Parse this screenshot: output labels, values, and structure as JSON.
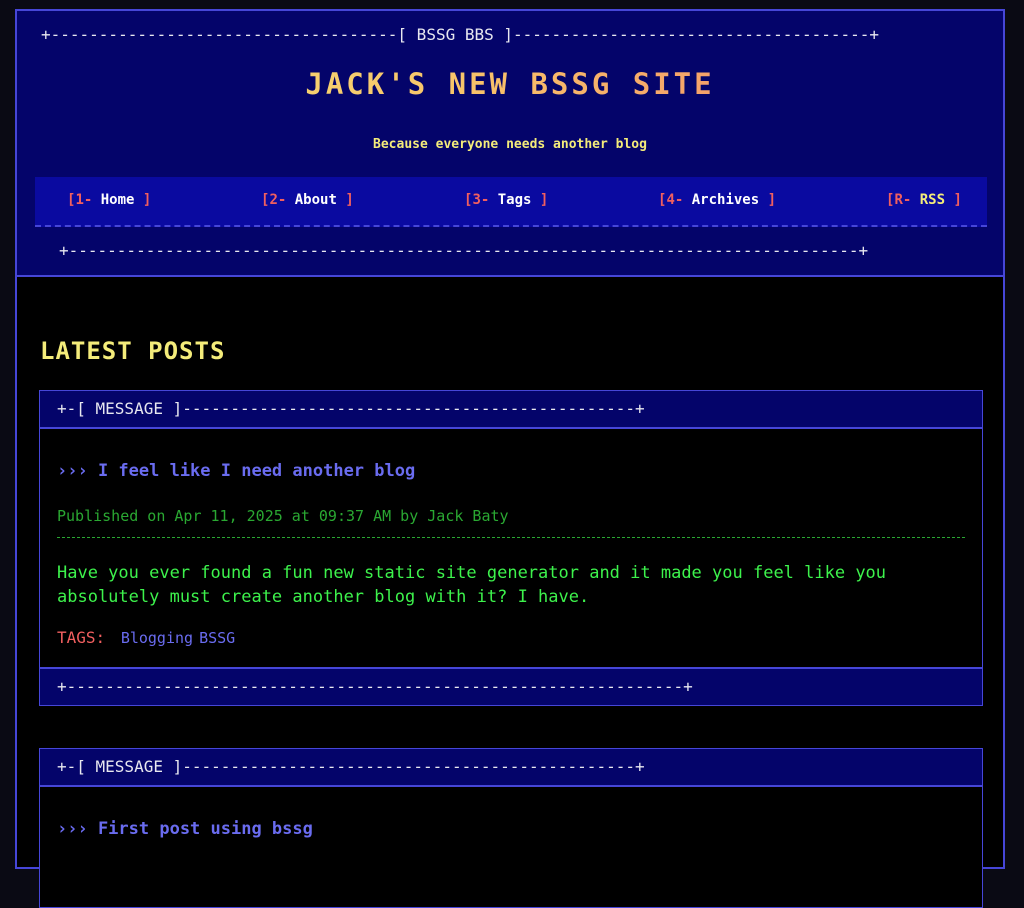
{
  "header": {
    "top_rule": "+------------------------------------[ BSSG BBS ]-------------------------------------+",
    "site_title": "JACK'S NEW BSSG SITE",
    "tagline": "Because everyone needs another blog",
    "bottom_rule": "+----------------------------------------------------------------------------------+"
  },
  "nav": {
    "items": [
      {
        "key": "1-",
        "label": "Home"
      },
      {
        "key": "2-",
        "label": "About"
      },
      {
        "key": "3-",
        "label": "Tags"
      },
      {
        "key": "4-",
        "label": "Archives"
      },
      {
        "key": "R-",
        "label": "RSS"
      }
    ],
    "open_bracket": "[",
    "close_bracket": "]"
  },
  "main": {
    "section_title": "LATEST POSTS",
    "posts": [
      {
        "header_rule": "+-[ MESSAGE ]-----------------------------------------------+",
        "title": "››› I feel like I need another blog",
        "meta": "Published on Apr 11, 2025 at 09:37 AM by Jack Baty",
        "body": "Have you ever found a fun new static site generator and it made you feel like you absolutely must create another blog with it? I have.",
        "tags_label": "TAGS:",
        "tags": [
          "Blogging",
          "BSSG"
        ],
        "footer_rule": "+----------------------------------------------------------------+"
      },
      {
        "header_rule": "+-[ MESSAGE ]-----------------------------------------------+",
        "title": "››› First post using bssg"
      }
    ]
  },
  "colors": {
    "frame_border": "#4646d8",
    "header_bg": "#04046a",
    "nav_bg": "#0a0aa0",
    "accent_yellow": "#f4ec7a",
    "accent_red": "#f15f5f",
    "link_blue": "#6a6cf0",
    "text_green": "#3df24c"
  }
}
